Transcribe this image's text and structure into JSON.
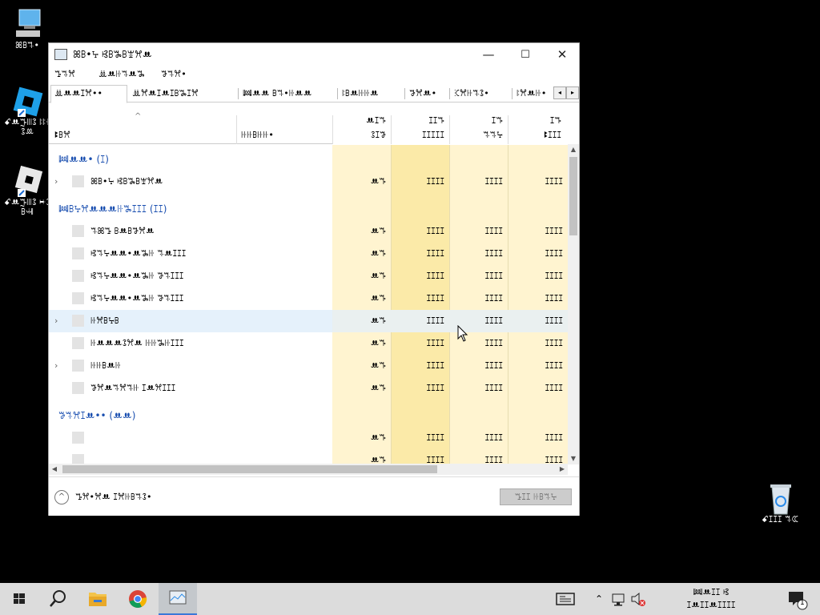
{
  "desktop": {
    "icons": [
      {
        "label": "ꕤꕗꕐ•"
      },
      {
        "label": "ꗃꔚꔓꔖꕘ ꖎꖎꖌꕘꔛ"
      },
      {
        "label": "ꗃꔚꔓꔖꕘ ꔜꕘꕗꕝ"
      },
      {
        "label": "ꗃꕯꕯꕯ ꕐꕆ"
      }
    ]
  },
  "window": {
    "title": "ꕤꕗ•ꕴ ꕙꕗꖆꕗꘄꕮꔚ",
    "controls": {
      "minimize": "—",
      "maximize": "☐",
      "close": "✕"
    },
    "menu": [
      "ꔤꕐꕮ",
      "ꔣꔚꖍꕐꔚꖆ",
      "ꖃꕐꕮ•"
    ],
    "tabs": [
      "ꔣꔚꔚꕯꕮ••",
      "ꔣꕮꔚꕯꔚꕯꕗꖆꕯꕮ",
      "ꔞꔚꔚ ꕗꕐ•ꖍꔚꔚ",
      "ꖎꕗꔚꖍꖍꔚ",
      "ꖃꕮꔚ•",
      "ꕿꕮꖍꕐꕘ•",
      "ꖎꕮꔚꖍ•"
    ],
    "scroll_left": "◂",
    "scroll_right": "▸",
    "columns": {
      "name": "ꔪꕗꕮ",
      "status": "ꖍꖍꕗꖍꖍ•",
      "cpu": {
        "pct": "ꔚꕯꔒ",
        "label": "ꕘꕯꖃ"
      },
      "memory": {
        "pct": "ꕯꕯꔒ",
        "label": "ꕯꕯꕯꕯꕯ"
      },
      "disk": {
        "pct": "ꕯꔒ",
        "label": "ꕐꕐꕴ"
      },
      "network": {
        "pct": "ꕯꔒ",
        "label": "ꔪꕯꕯꕯ"
      }
    },
    "rows": [
      {
        "kind": "group",
        "name": "ꔞꔚꔚ• (ꕯ)"
      },
      {
        "kind": "proc",
        "name": "ꕤꕗ•ꕴ ꕙꕗꖆꕗꘄꕮꔚ",
        "expand": true,
        "cpu": "ꔚꔒ",
        "mem": "ꕯꕯꕯꕯ",
        "disk": "ꕯꕯꕯꕯ",
        "net": "ꕯꕯꕯꕯ"
      },
      {
        "kind": "group",
        "name": "ꔞꕗꕴꕮꔚꔚꔚꖍꖆꕯꕯꕯ (ꕯꕯ)"
      },
      {
        "kind": "proc",
        "name": "ꕐꕤꔤ ꕗꔚꕗꖃꕮꔚ",
        "expand": false,
        "cpu": "ꔚꔒ",
        "mem": "ꕯꕯꕯꕯ",
        "disk": "ꕯꕯꕯꕯ",
        "net": "ꕯꕯꕯꕯ"
      },
      {
        "kind": "proc",
        "name": "ꕙꕐꕴꔚꔚ•ꔚꖆꖍ ꕐꔚꕯꕯꕯ",
        "expand": false,
        "cpu": "ꔚꔒ",
        "mem": "ꕯꕯꕯꕯ",
        "disk": "ꕯꕯꕯꕯ",
        "net": "ꕯꕯꕯꕯ"
      },
      {
        "kind": "proc",
        "name": "ꕙꕐꕴꔚꔚ•ꔚꖆꖍ ꖃꕐꕯꕯꕯ",
        "expand": false,
        "cpu": "ꔚꔒ",
        "mem": "ꕯꕯꕯꕯ",
        "disk": "ꕯꕯꕯꕯ",
        "net": "ꕯꕯꕯꕯ"
      },
      {
        "kind": "proc",
        "name": "ꕙꕐꕴꔚꔚ•ꔚꖆꖍ ꖃꕐꕯꕯꕯ",
        "expand": false,
        "cpu": "ꔚꔒ",
        "mem": "ꕯꕯꕯꕯ",
        "disk": "ꕯꕯꕯꕯ",
        "net": "ꕯꕯꕯꕯ"
      },
      {
        "kind": "proc",
        "name": "ꖍꕮꕗꕴꕗ",
        "expand": true,
        "selected": true,
        "cpu": "ꔚꔒ",
        "mem": "ꕯꕯꕯꕯ",
        "disk": "ꕯꕯꕯꕯ",
        "net": "ꕯꕯꕯꕯ"
      },
      {
        "kind": "proc",
        "name": "ꖍꔚꔚꔚꕘꕮꔚ ꖍꖍꖆꖍꕯꕯꕯ",
        "expand": false,
        "cpu": "ꔚꔒ",
        "mem": "ꕯꕯꕯꕯ",
        "disk": "ꕯꕯꕯꕯ",
        "net": "ꕯꕯꕯꕯ"
      },
      {
        "kind": "proc",
        "name": "ꖍꖍꕗꔚꖍ",
        "expand": true,
        "cpu": "ꔚꔒ",
        "mem": "ꕯꕯꕯꕯ",
        "disk": "ꕯꕯꕯꕯ",
        "net": "ꕯꕯꕯꕯ"
      },
      {
        "kind": "proc",
        "name": "ꖃꕮꔚꕐꕮꕐꖍ ꕯꔚꕮꕯꕯꕯ",
        "expand": false,
        "cpu": "ꔚꔒ",
        "mem": "ꕯꕯꕯꕯ",
        "disk": "ꕯꕯꕯꕯ",
        "net": "ꕯꕯꕯꕯ"
      },
      {
        "kind": "group",
        "name": "ꖃꕐꕮꕯꔚ•• (ꔚꔚ)"
      },
      {
        "kind": "proc",
        "name": "",
        "expand": false,
        "cpu": "ꔚꔒ",
        "mem": "ꕯꕯꕯꕯ",
        "disk": "ꕯꕯꕯꕯ",
        "net": "ꕯꕯꕯꕯ"
      },
      {
        "kind": "proc",
        "name": "",
        "expand": false,
        "cpu": "ꔚꔒ",
        "mem": "ꕯꕯꕯꕯ",
        "disk": "ꕯꕯꕯꕯ",
        "net": "ꕯꕯꕯꕯ"
      }
    ],
    "footer": {
      "fewer_details": "ꔤꕮ•ꕮꔚ ꕯꕮꖍꕗꕐꕘ•",
      "end_task": "ꔤꕯꕯ ꖍꕗꕐꕴ"
    }
  },
  "taskbar": {
    "clock_time": "ꔞꔚꕯꕯ ꕙ",
    "clock_date": "ꕯꔚꕯꕯꔚꕯꕯꕯꕯ",
    "notification_count": "1"
  },
  "colors": {
    "accent_blue": "#1a4fb0",
    "heat_light": "#fff4d0",
    "heat_mid": "#fbeaa8",
    "selection": "#e5f1fb"
  }
}
